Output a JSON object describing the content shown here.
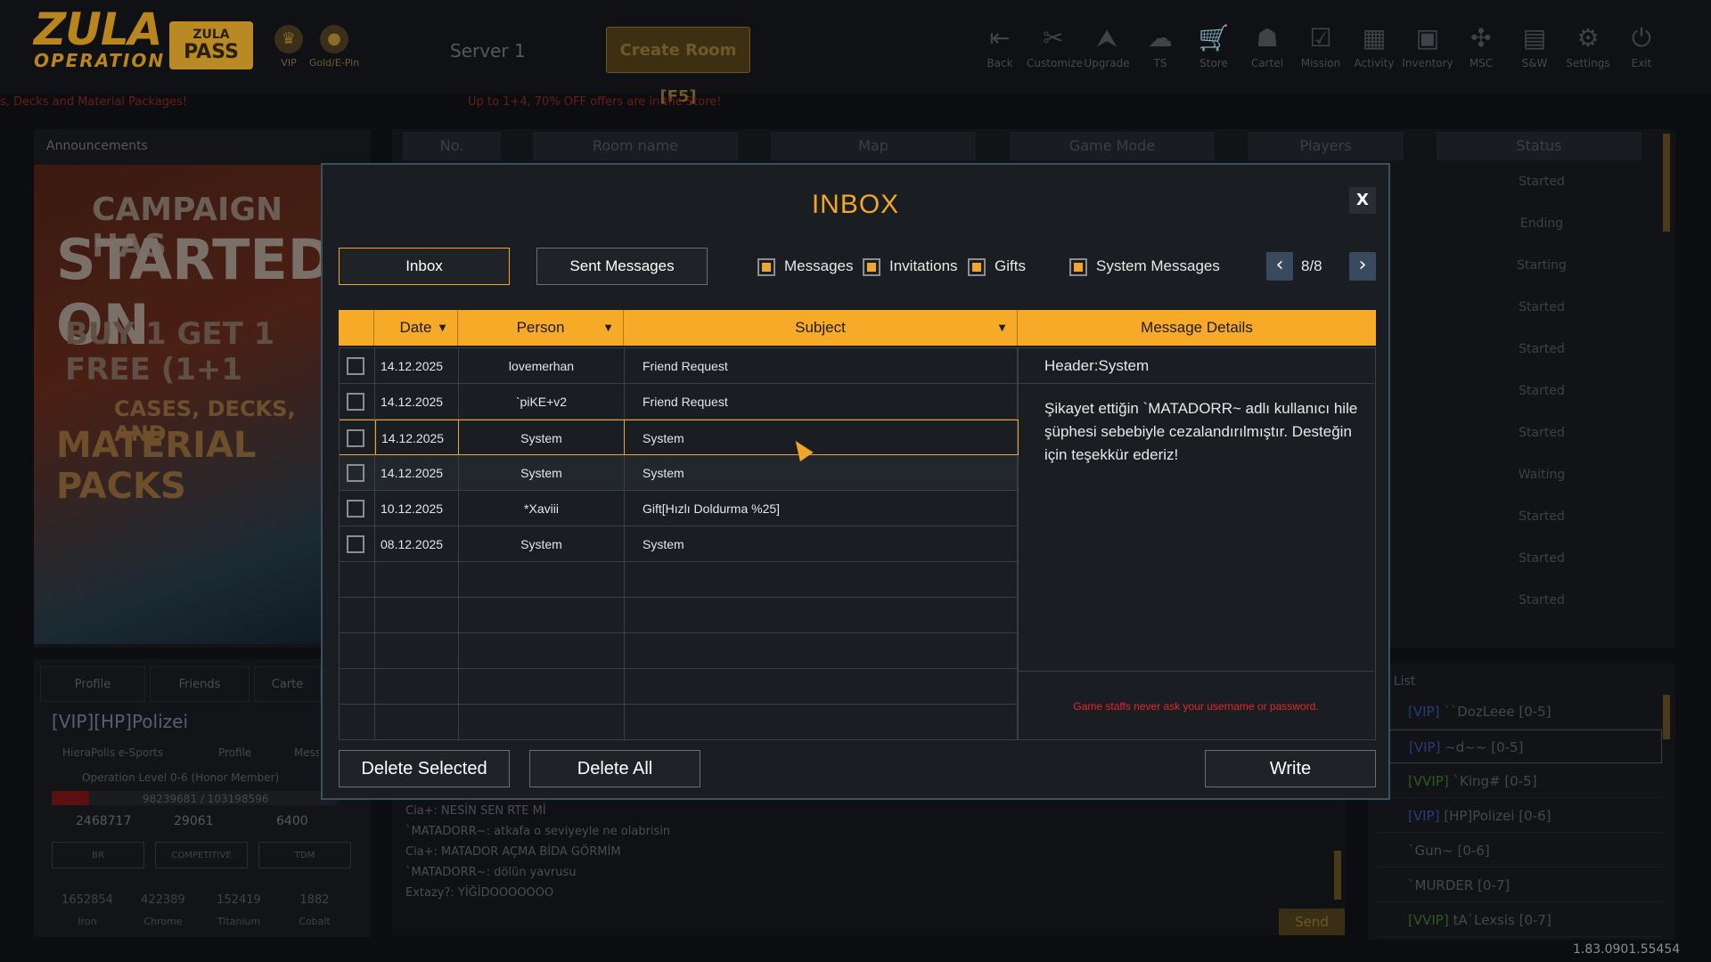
{
  "app": {
    "version": "1.83.0901.55454"
  },
  "logo": {
    "line1": "ZULA",
    "line2": "OPERATION"
  },
  "header": {
    "pass_line1": "ZULA",
    "pass_line2": "PASS",
    "vip_label": "VIP",
    "gold_label": "Gold/E-Pin",
    "server": "Server 1",
    "create_room": "Create Room [F5]",
    "nav": [
      "Back",
      "Customize",
      "Upgrade",
      "TS",
      "Store",
      "Cartel",
      "Mission",
      "Activity",
      "Inventory",
      "MSC",
      "S&W",
      "Settings",
      "Exit"
    ]
  },
  "marquee": {
    "left": "s, Decks and Material Packages!",
    "right": "Up to 1+4, 70% OFF offers are in the Store!"
  },
  "announcements": {
    "title": "Announcements",
    "banner_lines": [
      "CAMPAIGN HAS",
      "STARTED ON",
      "BUY 1 GET 1 FREE (1+1",
      "CASES, DECKS, AND",
      "MATERIAL PACKS"
    ]
  },
  "rooms": {
    "headers": [
      "No.",
      "Room name",
      "Map",
      "Game Mode",
      "Players",
      "Status"
    ],
    "statuses": [
      "Started",
      "Ending",
      "Starting",
      "Started",
      "Started",
      "Started",
      "Started",
      "Waiting",
      "Started",
      "Started",
      "Started"
    ]
  },
  "profile": {
    "tabs": [
      "Profile",
      "Friends",
      "Carte"
    ],
    "name_prefix": "[VIP]",
    "name": "[HP]Polizei",
    "clan": "HieraPolis e-Sports",
    "profile_btn": "Profile",
    "msg_btn": "Mess",
    "level": "Operation Level 0-6 (Honor Member)",
    "xp": "98239681 / 103198596",
    "stat1": "2468717",
    "stat2": "29061",
    "stat3": "6400",
    "modes": [
      "BR",
      "COMPETITIVE",
      "TDM"
    ],
    "resources": [
      {
        "value": "1652854",
        "label": "Iron"
      },
      {
        "value": "422389",
        "label": "Chrome"
      },
      {
        "value": "152419",
        "label": "Titanium"
      },
      {
        "value": "1882",
        "label": "Cobalt"
      }
    ]
  },
  "chat": {
    "lines": [
      "Cia+: NESİN SEN RTE Mİ",
      "`MATADORR~: atkafa o seviyeyle ne olabrisin",
      "Cia+: MATADOR AÇMA BİDA GÖRMİM",
      "`MATADORR~: dölün yavrusu",
      "Extazy?: YİĞİDOOOOOOO"
    ],
    "send": "Send"
  },
  "players": {
    "title": "er List",
    "list": [
      {
        "prefix": "[VIP]",
        "name": "``DozLeee [0-5]"
      },
      {
        "prefix": "[VIP]",
        "name": "~d~~ [0-5]"
      },
      {
        "prefix": "[VVIP]",
        "name": "`King# [0-5]"
      },
      {
        "prefix": "[VIP]",
        "name": "[HP]Polizei [0-6]"
      },
      {
        "prefix": "",
        "name": "`Gun~ [0-6]"
      },
      {
        "prefix": "",
        "name": "`MURDER [0-7]"
      },
      {
        "prefix": "[VVIP]",
        "name": "tA`Lexsis [0-7]"
      }
    ]
  },
  "inbox": {
    "title": "INBOX",
    "close": "X",
    "tab_inbox": "Inbox",
    "tab_sent": "Sent Messages",
    "filters": [
      {
        "label": "Messages",
        "checked": true
      },
      {
        "label": "Invitations",
        "checked": true
      },
      {
        "label": "Gifts",
        "checked": true
      },
      {
        "label": "System Messages",
        "checked": true
      }
    ],
    "page": "8/8",
    "columns": {
      "date": "Date",
      "person": "Person",
      "subject": "Subject",
      "details": "Message Details"
    },
    "messages": [
      {
        "date": "14.12.2025",
        "person": "lovemerhan",
        "subject": "Friend Request"
      },
      {
        "date": "14.12.2025",
        "person": "`piKE+v2",
        "subject": "Friend Request"
      },
      {
        "date": "14.12.2025",
        "person": "System",
        "subject": "System"
      },
      {
        "date": "14.12.2025",
        "person": "System",
        "subject": "System"
      },
      {
        "date": "10.12.2025",
        "person": "*Xaviii",
        "subject": "Gift[Hızlı Doldurma %25]"
      },
      {
        "date": "08.12.2025",
        "person": "System",
        "subject": "System"
      }
    ],
    "detail_header": "Header:System",
    "detail_body": "Şikayet ettiğin `MATADORR~ adlı kullanıcı hile şüphesi sebebiyle cezalandırılmıştır. Desteğin için teşekkür ederiz!",
    "warning": "Game staffs never ask your username or password.",
    "btn_delete_selected": "Delete Selected",
    "btn_delete_all": "Delete All",
    "btn_write": "Write"
  },
  "colors": {
    "accent": "#f7a928",
    "warning": "#e02a2a",
    "page_btn": "#3a4a5e"
  }
}
